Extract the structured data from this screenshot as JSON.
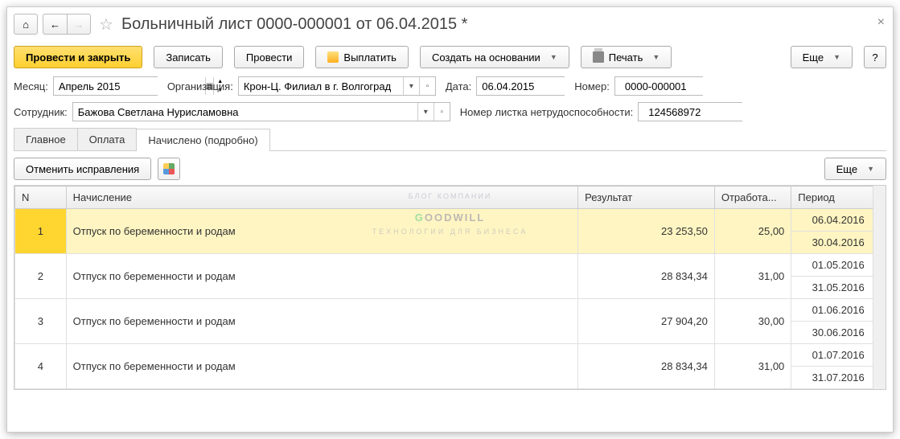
{
  "header": {
    "title": "Больничный лист 0000-000001 от 06.04.2015 *"
  },
  "toolbar": {
    "post_close": "Провести и закрыть",
    "save": "Записать",
    "post": "Провести",
    "pay": "Выплатить",
    "create_based": "Создать на основании",
    "print": "Печать",
    "more": "Еще",
    "help": "?"
  },
  "form": {
    "month_lbl": "Месяц:",
    "month_val": "Апрель 2015",
    "org_lbl": "Организация:",
    "org_val": "Крон-Ц. Филиал в г. Волгоград",
    "date_lbl": "Дата:",
    "date_val": "06.04.2015",
    "number_lbl": "Номер:",
    "number_val": "0000-000001",
    "employee_lbl": "Сотрудник:",
    "employee_val": "Бажова Светлана Нурисламовна",
    "sheet_num_lbl": "Номер листка нетрудоспособности:",
    "sheet_num_val": "124568972"
  },
  "tabs": {
    "main": "Главное",
    "payment": "Оплата",
    "accrued": "Начислено (подробно)"
  },
  "sub_toolbar": {
    "cancel_fixes": "Отменить исправления",
    "more": "Еще"
  },
  "table": {
    "headers": {
      "n": "N",
      "accrual": "Начисление",
      "result": "Результат",
      "worked": "Отработа...",
      "period": "Период"
    },
    "rows": [
      {
        "n": "1",
        "accrual": "Отпуск по беременности и родам",
        "result": "23 253,50",
        "worked": "25,00",
        "period1": "06.04.2016",
        "period2": "30.04.2016",
        "selected": true
      },
      {
        "n": "2",
        "accrual": "Отпуск по беременности и родам",
        "result": "28 834,34",
        "worked": "31,00",
        "period1": "01.05.2016",
        "period2": "31.05.2016"
      },
      {
        "n": "3",
        "accrual": "Отпуск по беременности и родам",
        "result": "27 904,20",
        "worked": "30,00",
        "period1": "01.06.2016",
        "period2": "30.06.2016"
      },
      {
        "n": "4",
        "accrual": "Отпуск по беременности и родам",
        "result": "28 834,34",
        "worked": "31,00",
        "period1": "01.07.2016",
        "period2": "31.07.2016"
      }
    ]
  },
  "watermark": {
    "top": "БЛОГ КОМПАНИИ",
    "g": "G",
    "rest": "OODWILL",
    "sub": "ТЕХНОЛОГИИ ДЛЯ БИЗНЕСА"
  }
}
